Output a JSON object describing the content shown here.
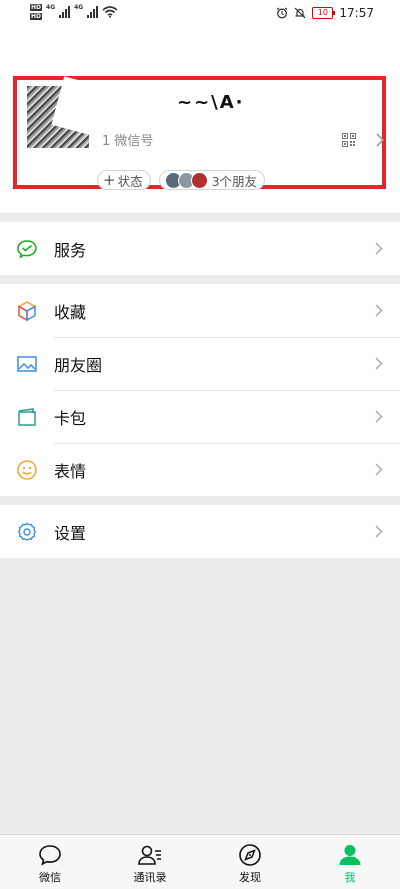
{
  "status_bar": {
    "hd1": "HD",
    "hd2": "HD",
    "net1": "4G",
    "net2": "4G",
    "battery": "10",
    "time": "17:57"
  },
  "profile": {
    "nickname": "~~\\A·",
    "wechat_id_label": "1 微信号",
    "status_chip": "状态",
    "friends_chip": "3个朋友"
  },
  "menu": {
    "services": {
      "label": "服务",
      "icon": "wechat-pay-icon"
    },
    "favorites": {
      "label": "收藏",
      "icon": "cube-icon"
    },
    "moments": {
      "label": "朋友圈",
      "icon": "image-icon"
    },
    "cards": {
      "label": "卡包",
      "icon": "wallet-icon"
    },
    "stickers": {
      "label": "表情",
      "icon": "smiley-icon"
    },
    "settings": {
      "label": "设置",
      "icon": "gear-icon"
    }
  },
  "tabbar": {
    "chats": "微信",
    "contacts": "通讯录",
    "discover": "发现",
    "me": "我"
  },
  "colors": {
    "accent": "#07c160",
    "highlight": "#e5242b",
    "battery": "#dd0000"
  }
}
